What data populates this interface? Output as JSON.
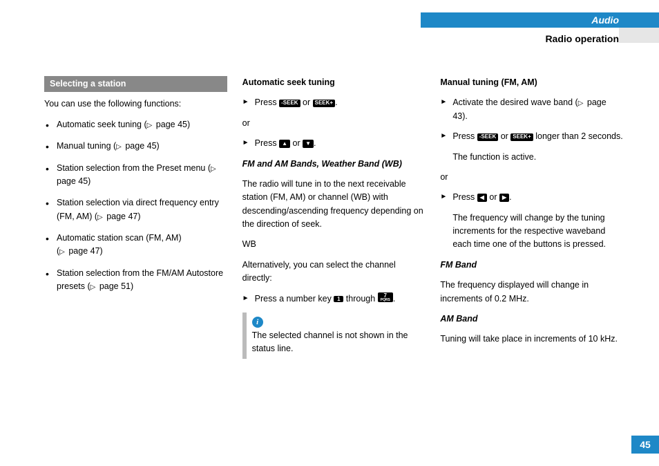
{
  "header": {
    "section": "Audio",
    "subsection": "Radio operation",
    "page_number": "45"
  },
  "col1": {
    "section_title": "Selecting a station",
    "intro": "You can use the following functions:",
    "items": [
      {
        "text": "Automatic seek tuning (",
        "ref": " page 45)"
      },
      {
        "text": "Manual tuning (",
        "ref": " page 45)"
      },
      {
        "text": "Station selection from the Preset menu (",
        "ref": " page 45)"
      },
      {
        "text": "Station selection via direct frequency entry (FM, AM) (",
        "ref": " page 47)"
      },
      {
        "text": "Automatic station scan (FM, AM) (",
        "ref": " page 47)"
      },
      {
        "text": "Station selection from the FM/AM Autostore presets (",
        "ref": " page 51)"
      }
    ]
  },
  "col2": {
    "h1": "Automatic seek tuning",
    "s1a": "Press ",
    "s1b": " or ",
    "s1c": ".",
    "or": "or",
    "s2a": "Press ",
    "s2b": " or ",
    "s2c": ".",
    "h2": "FM and AM Bands, Weather Band (WB)",
    "p2": "The radio will tune in to the next receivable station (FM, AM) or channel (WB) with descending/ascending frequency depending on the direction of seek.",
    "wb": "WB",
    "p3": "Alternatively, you can select the channel directly:",
    "s3a": "Press a number key ",
    "s3b": " through ",
    "s3c": ".",
    "info": "The selected channel is not shown in the status line."
  },
  "col3": {
    "h1": "Manual tuning (FM, AM)",
    "s1a": "Activate the desired wave band (",
    "s1ref": " page 43).",
    "s2a": "Press ",
    "s2b": " or ",
    "s2c": " longer than 2 seconds.",
    "s2r": "The function is active.",
    "or": "or",
    "s3a": "Press ",
    "s3b": " or ",
    "s3c": ".",
    "s3r": "The frequency will change by the tuning increments for the respective waveband each time one of the buttons is pressed.",
    "h2": "FM Band",
    "p2": "The frequency displayed will change in increments of 0.2 MHz.",
    "h3": "AM Band",
    "p3": "Tuning will take place in increments of 10 kHz."
  },
  "icons": {
    "seek_minus": "-SEEK",
    "seek_plus": "SEEK+",
    "up": "▲",
    "down": "▼",
    "left": "◀",
    "right": "▶",
    "num1": "1",
    "num7": "7",
    "num7sub": "PQRS",
    "info": "i"
  }
}
